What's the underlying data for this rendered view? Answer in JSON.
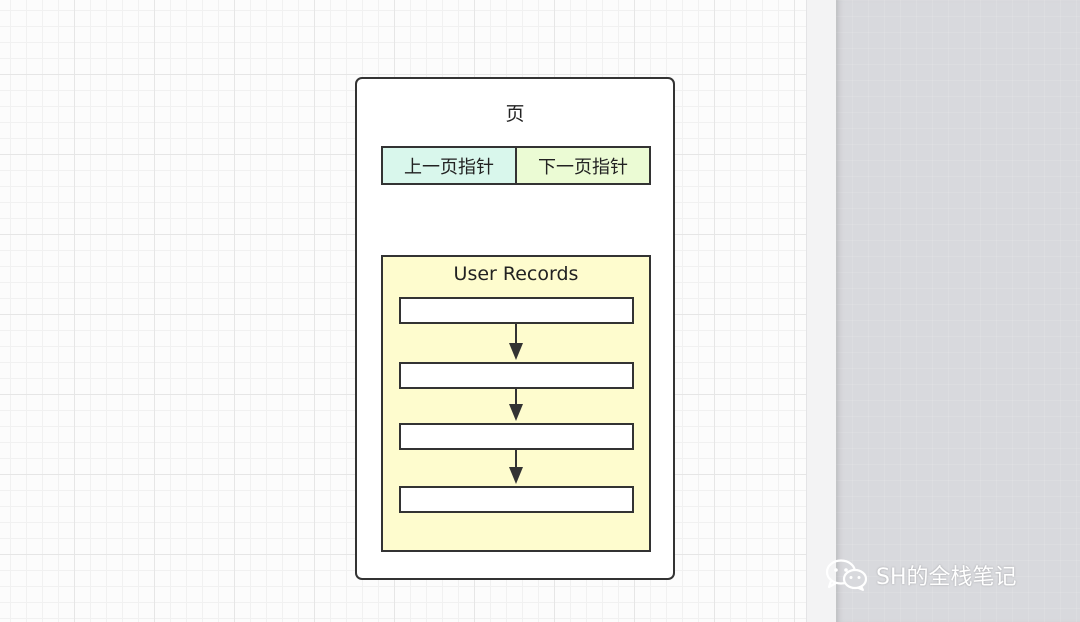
{
  "diagram": {
    "page_title": "页",
    "prev_pointer": "上一页指针",
    "next_pointer": "下一页指针",
    "records_label": "User Records",
    "records": [
      {
        "label": ""
      },
      {
        "label": ""
      },
      {
        "label": ""
      },
      {
        "label": ""
      }
    ]
  },
  "watermark": {
    "text": "SH的全栈笔记",
    "icon": "wechat-icon"
  },
  "colors": {
    "prev_pointer_fill": "#d9f7ec",
    "next_pointer_fill": "#ebfbd4",
    "records_fill": "#fefcce",
    "stroke": "#333333"
  }
}
